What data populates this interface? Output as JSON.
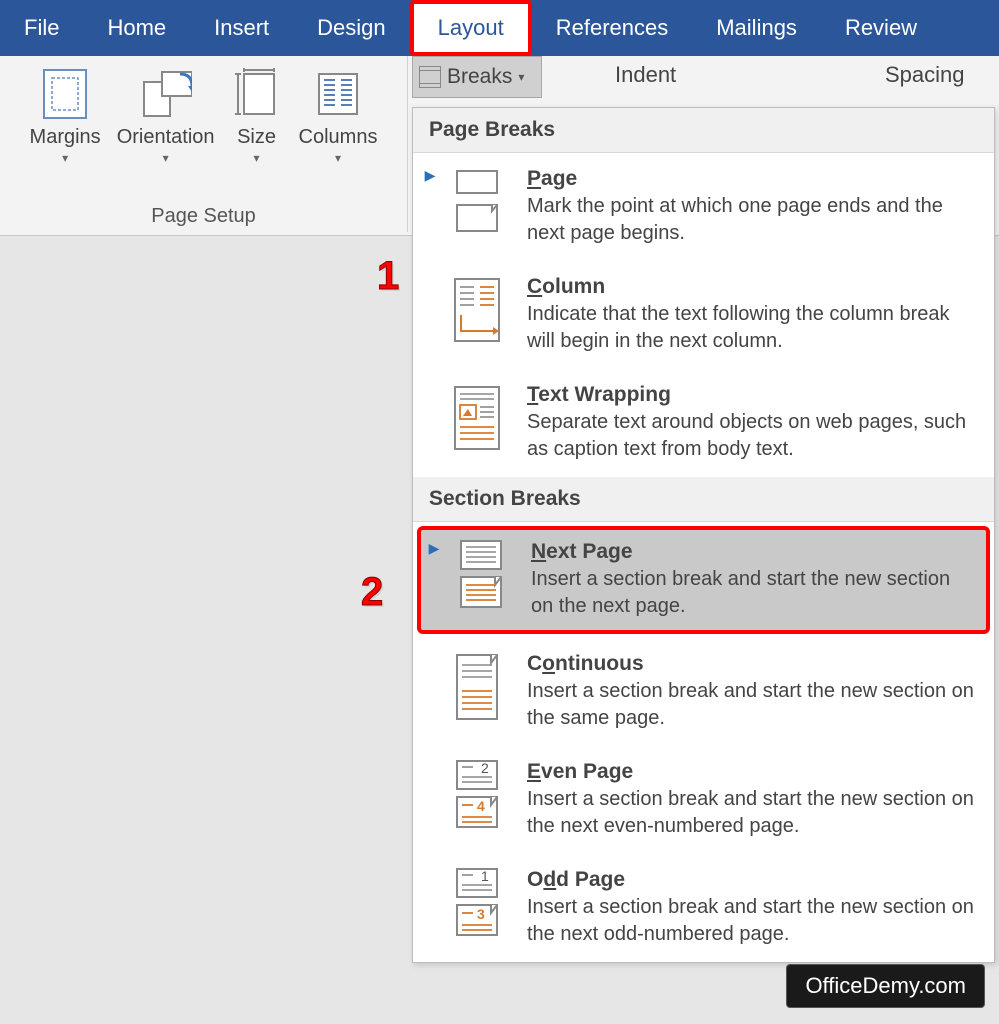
{
  "tabs": {
    "items": [
      "File",
      "Home",
      "Insert",
      "Design",
      "Layout",
      "References",
      "Mailings",
      "Review"
    ],
    "active_index": 4
  },
  "page_setup": {
    "group_label": "Page Setup",
    "buttons": {
      "margins": "Margins",
      "orientation": "Orientation",
      "size": "Size",
      "columns": "Columns"
    }
  },
  "breaks_button": "Breaks",
  "right_header": {
    "indent": "Indent",
    "spacing": "Spacing"
  },
  "breaks_menu": {
    "page_breaks_header": "Page Breaks",
    "section_breaks_header": "Section Breaks",
    "page": {
      "title": "Page",
      "desc": "Mark the point at which one page ends and the next page begins."
    },
    "column": {
      "title": "Column",
      "desc": "Indicate that the text following the column break will begin in the next column."
    },
    "text_wrapping": {
      "title": "Text Wrapping",
      "desc": "Separate text around objects on web pages, such as caption text from body text."
    },
    "next_page": {
      "title": "Next Page",
      "desc": "Insert a section break and start the new section on the next page."
    },
    "continuous": {
      "title": "Continuous",
      "desc": "Insert a section break and start the new section on the same page."
    },
    "even_page": {
      "title": "Even Page",
      "desc": "Insert a section break and start the new section on the next even-numbered page."
    },
    "odd_page": {
      "title": "Odd Page",
      "desc": "Insert a section break and start the new section on the next odd-numbered page."
    }
  },
  "annotations": {
    "one": "1",
    "two": "2"
  },
  "watermark": "OfficeDemy.com"
}
